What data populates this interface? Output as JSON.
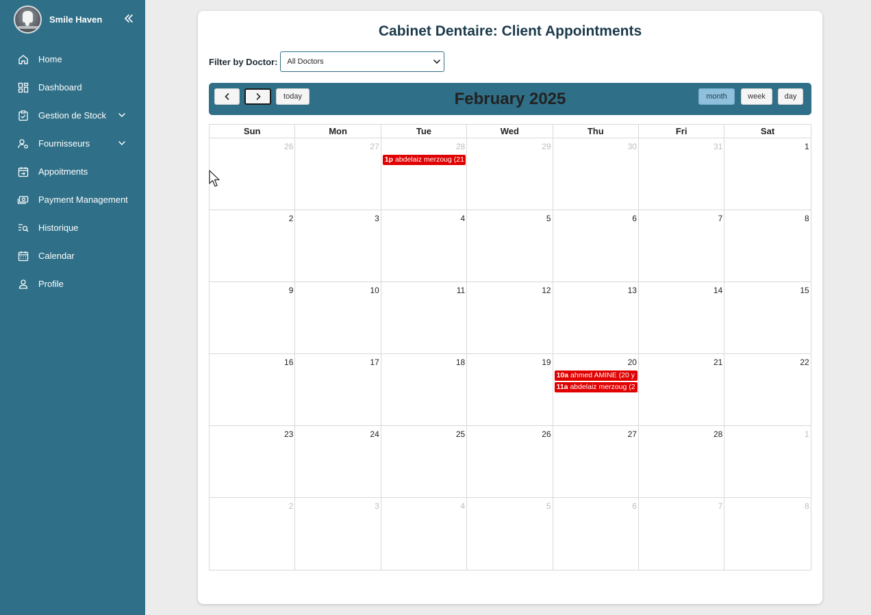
{
  "sidebar": {
    "brand_name": "Smile Haven",
    "items": [
      {
        "label": "Home",
        "icon": "home-icon"
      },
      {
        "label": "Dashboard",
        "icon": "dashboard-icon"
      },
      {
        "label": "Gestion de Stock",
        "icon": "clipboard-check-icon",
        "expandable": true
      },
      {
        "label": "Fournisseurs",
        "icon": "user-settings-icon",
        "expandable": true
      },
      {
        "label": "Appoitments",
        "icon": "calendar-arrow-icon"
      },
      {
        "label": "Payment Management",
        "icon": "money-icon"
      },
      {
        "label": "Historique",
        "icon": "list-search-icon"
      },
      {
        "label": "Calendar",
        "icon": "calendar-icon"
      },
      {
        "label": "Profile",
        "icon": "user-icon"
      }
    ]
  },
  "main": {
    "title": "Cabinet Dentaire: Client Appointments",
    "filter_label": "Filter by Doctor:",
    "filter_value": "All Doctors"
  },
  "calendar": {
    "month_title": "February 2025",
    "prev_icon": "chevron-left-icon",
    "next_icon": "chevron-right-icon",
    "today_label": "today",
    "view_buttons": [
      "month",
      "week",
      "day"
    ],
    "active_view": "month",
    "weekdays": [
      "Sun",
      "Mon",
      "Tue",
      "Wed",
      "Thu",
      "Fri",
      "Sat"
    ],
    "weeks": [
      [
        {
          "d": "26",
          "o": true
        },
        {
          "d": "27",
          "o": true
        },
        {
          "d": "28",
          "o": true
        },
        {
          "d": "29",
          "o": true
        },
        {
          "d": "30",
          "o": true
        },
        {
          "d": "31",
          "o": true
        },
        {
          "d": "1",
          "o": false
        }
      ],
      [
        {
          "d": "2"
        },
        {
          "d": "3"
        },
        {
          "d": "4"
        },
        {
          "d": "5"
        },
        {
          "d": "6"
        },
        {
          "d": "7"
        },
        {
          "d": "8"
        }
      ],
      [
        {
          "d": "9"
        },
        {
          "d": "10"
        },
        {
          "d": "11"
        },
        {
          "d": "12"
        },
        {
          "d": "13"
        },
        {
          "d": "14"
        },
        {
          "d": "15"
        }
      ],
      [
        {
          "d": "16"
        },
        {
          "d": "17"
        },
        {
          "d": "18"
        },
        {
          "d": "19"
        },
        {
          "d": "20"
        },
        {
          "d": "21"
        },
        {
          "d": "22"
        }
      ],
      [
        {
          "d": "23"
        },
        {
          "d": "24"
        },
        {
          "d": "25"
        },
        {
          "d": "26"
        },
        {
          "d": "27"
        },
        {
          "d": "28"
        },
        {
          "d": "1",
          "o": true
        }
      ],
      [
        {
          "d": "2",
          "o": true
        },
        {
          "d": "3",
          "o": true
        },
        {
          "d": "4",
          "o": true
        },
        {
          "d": "5",
          "o": true
        },
        {
          "d": "6",
          "o": true
        },
        {
          "d": "7",
          "o": true
        },
        {
          "d": "8",
          "o": true
        }
      ]
    ],
    "events": [
      {
        "week": 0,
        "day": 2,
        "time": "1p",
        "title": "abdelaiz merzoug (21"
      },
      {
        "week": 3,
        "day": 4,
        "time": "10a",
        "title": "ahmed AMINE (20 y"
      },
      {
        "week": 3,
        "day": 4,
        "time": "11a",
        "title": "abdelaiz merzoug (2"
      }
    ],
    "event_color": "#e00000"
  },
  "colors": {
    "sidebar": "#2f6f87",
    "toolbar": "#2f6f87",
    "title": "#1b3a4b"
  }
}
